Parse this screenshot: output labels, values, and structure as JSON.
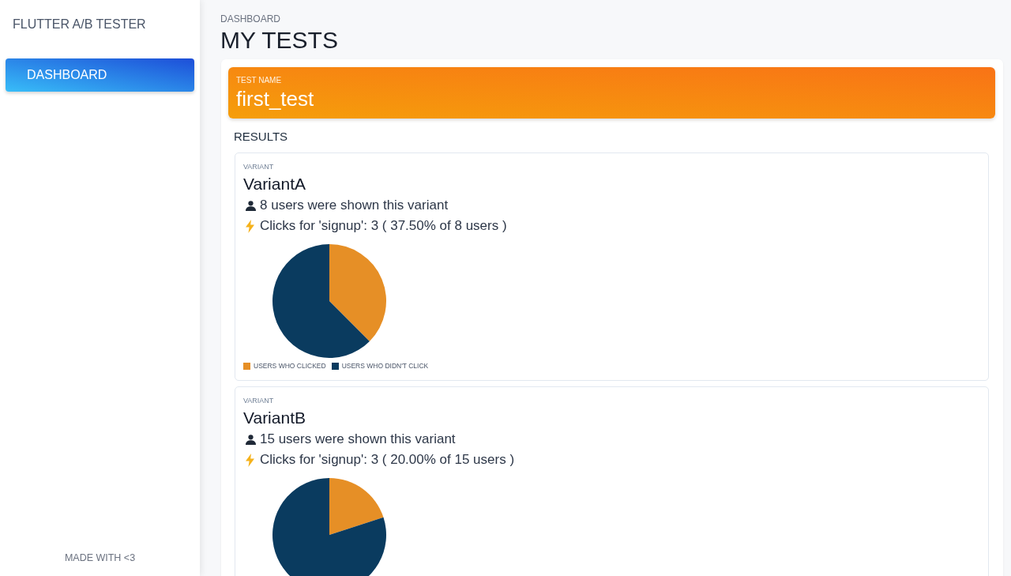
{
  "sidebar": {
    "title": "FLUTTER A/B TESTER",
    "items": [
      {
        "label": "DASHBOARD",
        "selected": true
      }
    ],
    "footer": "MADE WITH <3"
  },
  "header": {
    "breadcrumb": "DASHBOARD",
    "title": "MY TESTS"
  },
  "test": {
    "label": "TEST NAME",
    "name": "first_test"
  },
  "results": {
    "heading": "RESULTS",
    "variants": [
      {
        "label": "VARIANT",
        "name": "VariantA",
        "shown": "8 users were shown this variant",
        "clicks": "Clicks for 'signup': 3 ( 37.50% of 8 users )",
        "chart_data": [
          {
            "type": "pie",
            "categories": [
              "USERS WHO CLICKED",
              "USERS WHO DIDN'T CLICK"
            ],
            "values": [
              37.5,
              62.5
            ],
            "colors": [
              "#e68f26",
              "#0a3b5f"
            ],
            "legend": "bottom"
          }
        ]
      },
      {
        "label": "VARIANT",
        "name": "VariantB",
        "shown": "15 users were shown this variant",
        "clicks": "Clicks for 'signup': 3 ( 20.00% of 15 users )",
        "chart_data": [
          {
            "type": "pie",
            "values": [
              20,
              80
            ],
            "colors": [
              "#e68f26",
              "#0a3b5f"
            ]
          }
        ]
      }
    ]
  }
}
